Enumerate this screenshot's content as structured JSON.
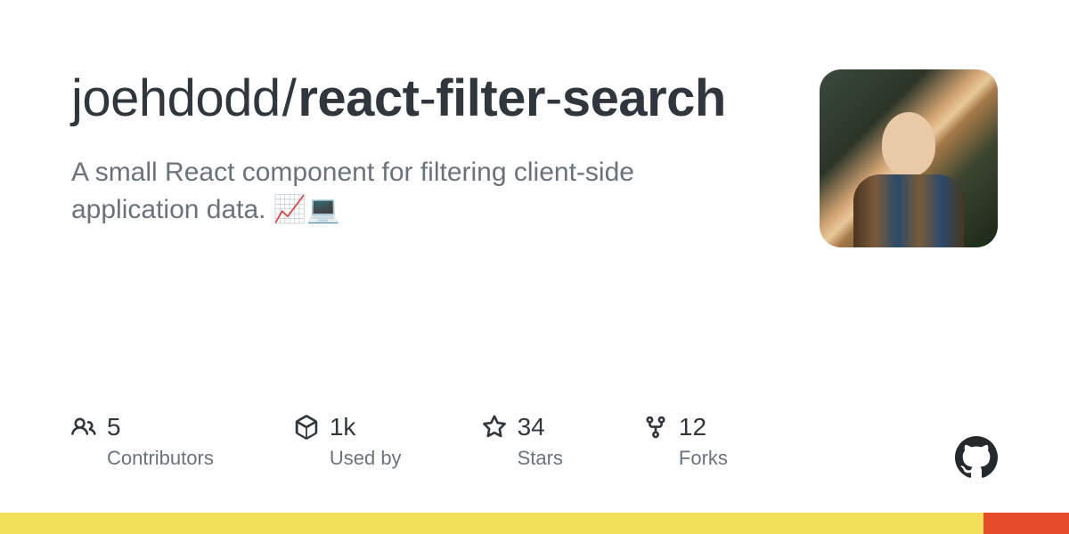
{
  "repo": {
    "owner": "joehdodd",
    "slash": "/",
    "name_parts": {
      "p1": "react",
      "sep1": "-",
      "p2": "filter",
      "sep2": "-",
      "p3": "search"
    },
    "description": "A small React component for filtering client-side application data. 📈💻"
  },
  "stats": {
    "contributors": {
      "value": "5",
      "label": "Contributors"
    },
    "usedby": {
      "value": "1k",
      "label": "Used by"
    },
    "stars": {
      "value": "34",
      "label": "Stars"
    },
    "forks": {
      "value": "12",
      "label": "Forks"
    }
  }
}
